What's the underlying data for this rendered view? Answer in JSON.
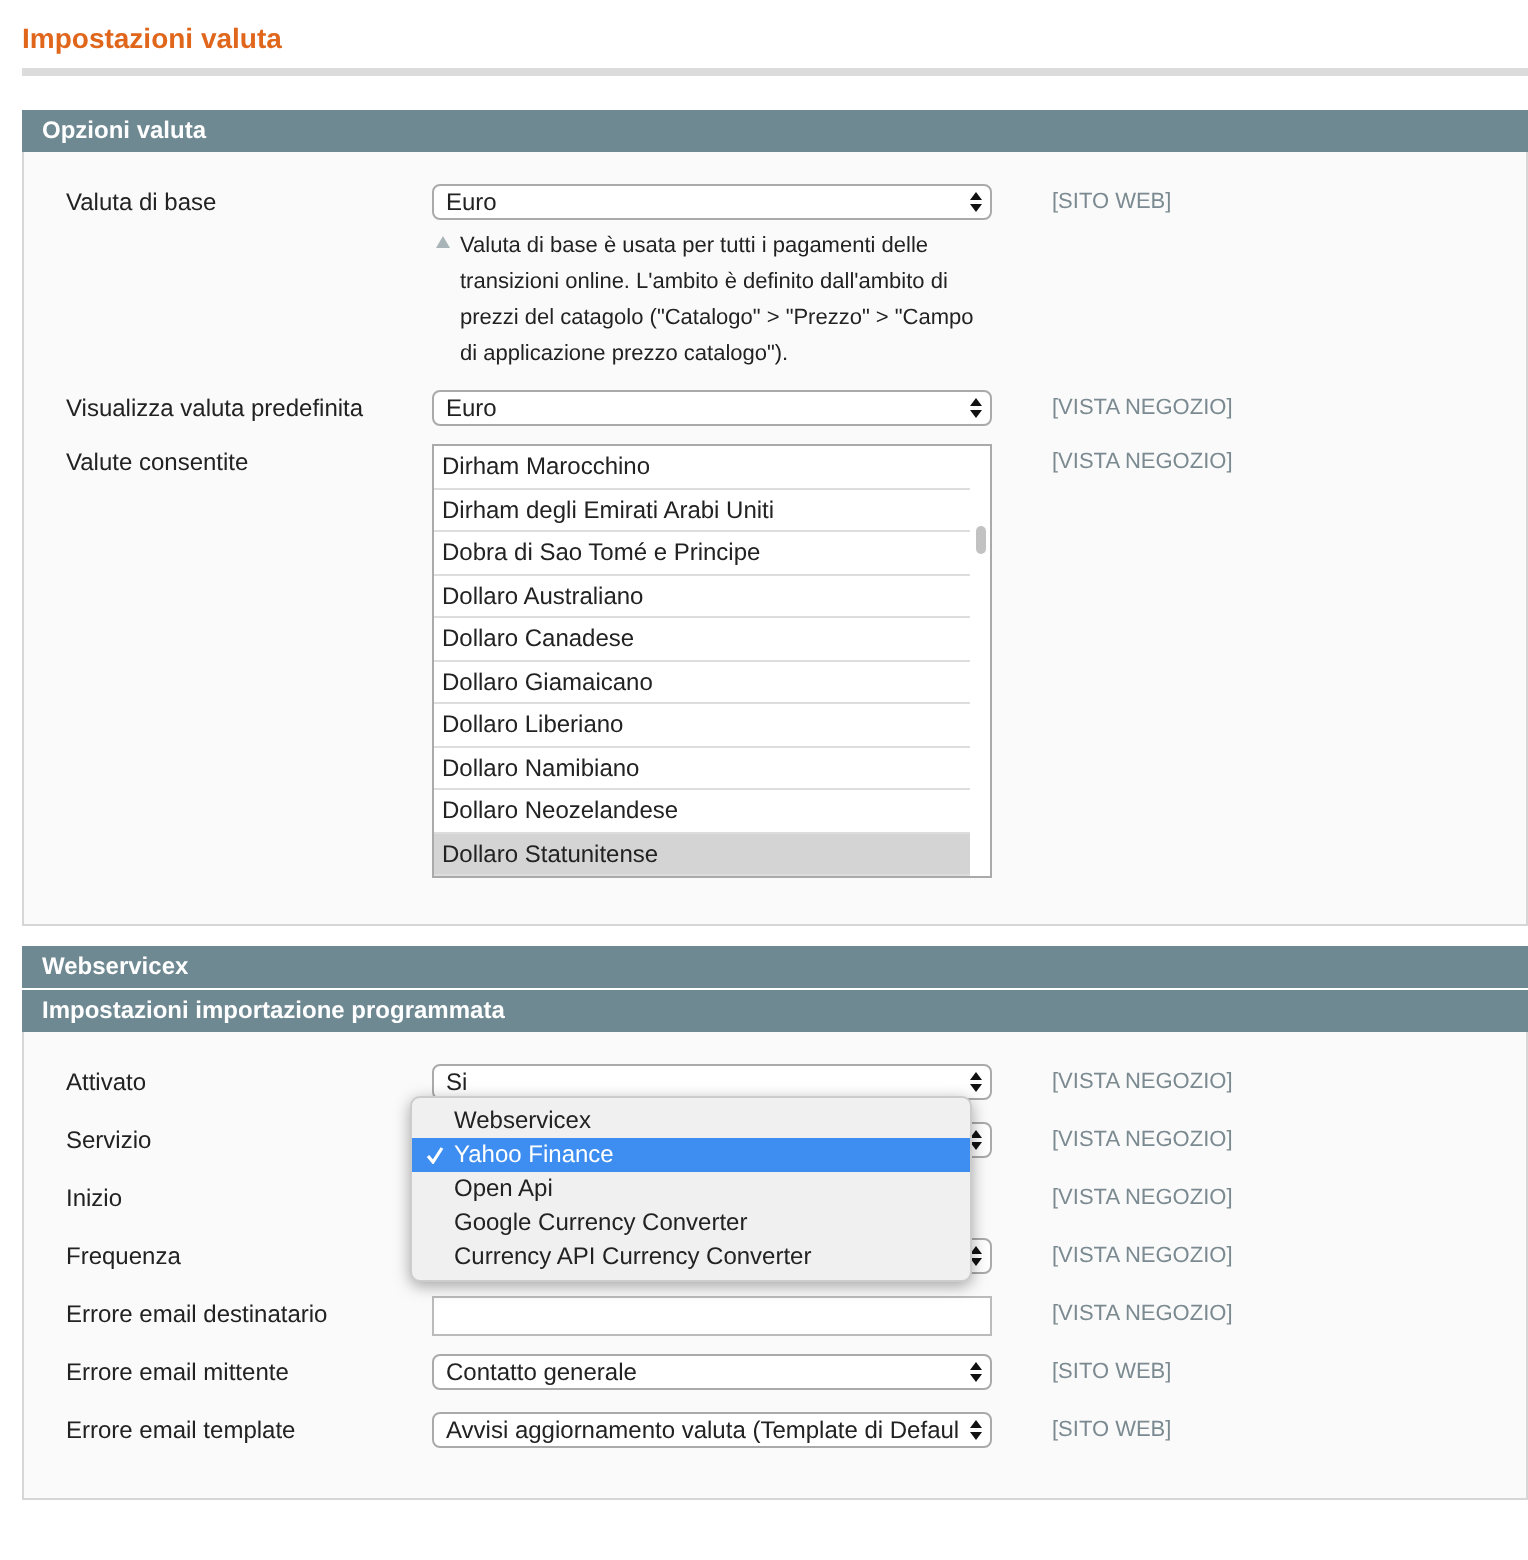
{
  "page_title": "Impostazioni valuta",
  "sections": [
    {
      "headers": [
        "Opzioni valuta"
      ],
      "rows": [
        {
          "kind": "select",
          "label": "Valuta di base",
          "value": "Euro",
          "scope": "[SITO WEB]",
          "note": "Valuta di base è usata per tutti i pagamenti delle transizioni online. L'ambito è definito dall'ambito di prezzi del catagolo (\"Catalogo\" > \"Prezzo\" > \"Campo di applicazione prezzo catalogo\")."
        },
        {
          "kind": "select",
          "label": "Visualizza valuta predefinita",
          "value": "Euro",
          "scope": "[VISTA NEGOZIO]"
        },
        {
          "kind": "listbox",
          "label": "Valute consentite",
          "scope": "[VISTA NEGOZIO]",
          "options": [
            {
              "label": "Dirham Marocchino",
              "selected": false
            },
            {
              "label": "Dirham degli Emirati Arabi Uniti",
              "selected": false
            },
            {
              "label": "Dobra di Sao Tomé e Principe",
              "selected": false
            },
            {
              "label": "Dollaro Australiano",
              "selected": false
            },
            {
              "label": "Dollaro Canadese",
              "selected": false
            },
            {
              "label": "Dollaro Giamaicano",
              "selected": false
            },
            {
              "label": "Dollaro Liberiano",
              "selected": false
            },
            {
              "label": "Dollaro Namibiano",
              "selected": false
            },
            {
              "label": "Dollaro Neozelandese",
              "selected": false
            },
            {
              "label": "Dollaro Statunitense",
              "selected": true
            }
          ]
        }
      ]
    },
    {
      "headers": [
        "Webservicex",
        "Impostazioni importazione programmata"
      ],
      "rows": [
        {
          "kind": "select",
          "label": "Attivato",
          "value": "Si",
          "scope": "[VISTA NEGOZIO]"
        },
        {
          "kind": "select",
          "label": "Servizio",
          "scope": "[VISTA NEGOZIO]",
          "open_menu": [
            {
              "label": "Webservicex",
              "selected": false
            },
            {
              "label": "Yahoo Finance",
              "selected": true
            },
            {
              "label": "Open Api",
              "selected": false
            },
            {
              "label": "Google Currency Converter",
              "selected": false
            },
            {
              "label": "Currency API Currency Converter",
              "selected": false
            }
          ]
        },
        {
          "kind": "none",
          "label": "Inizio",
          "scope": "[VISTA NEGOZIO]"
        },
        {
          "kind": "select",
          "label": "Frequenza",
          "scope": "[VISTA NEGOZIO]"
        },
        {
          "kind": "text",
          "label": "Errore email destinatario",
          "scope": "[VISTA NEGOZIO]"
        },
        {
          "kind": "select",
          "label": "Errore email mittente",
          "value": "Contatto generale",
          "scope": "[SITO WEB]"
        },
        {
          "kind": "select",
          "label": "Errore email template",
          "value": "Avvisi aggiornamento valuta (Template di Defaul",
          "scope": "[SITO WEB]"
        }
      ]
    }
  ]
}
